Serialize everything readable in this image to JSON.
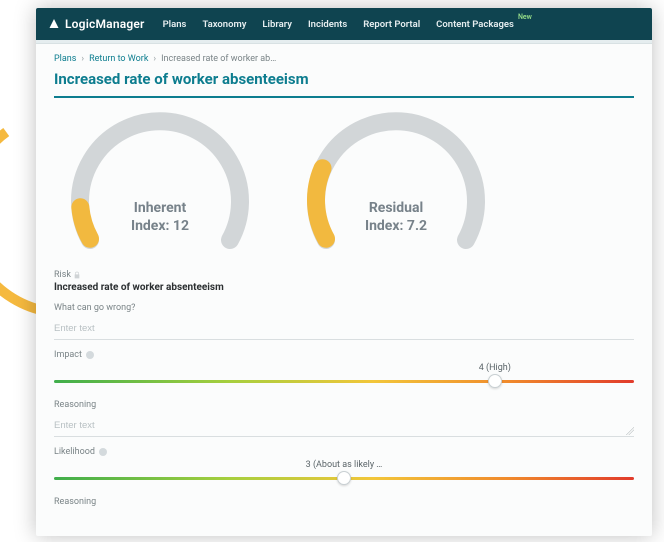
{
  "brand": "LogicManager",
  "nav": {
    "items": [
      "Plans",
      "Taxonomy",
      "Library",
      "Incidents",
      "Report Portal",
      "Content Packages"
    ],
    "new_badge": "New"
  },
  "breadcrumb": {
    "items": [
      "Plans",
      "Return to Work",
      "Increased rate of worker ab…"
    ]
  },
  "page_title": "Increased rate of worker absenteeism",
  "gauges": {
    "inherent": {
      "title": "Inherent",
      "index_label": "Index:",
      "value": 12,
      "fraction": 0.1
    },
    "residual": {
      "title": "Residual",
      "index_label": "Index:",
      "value": 7.2,
      "fraction": 0.22
    }
  },
  "risk": {
    "section_label": "Risk",
    "name": "Increased rate of worker absenteeism"
  },
  "fields": {
    "what_wrong": {
      "label": "What can go wrong?",
      "placeholder": "Enter text",
      "value": ""
    },
    "impact": {
      "label": "Impact",
      "value_label": "4 (High)",
      "position_pct": 76
    },
    "reasoning1": {
      "label": "Reasoning",
      "placeholder": "Enter text",
      "value": ""
    },
    "likelihood": {
      "label": "Likelihood",
      "value_label": "3 (About as likely …",
      "position_pct": 50
    },
    "reasoning2": {
      "label": "Reasoning"
    }
  },
  "colors": {
    "accent": "#0d7d8f",
    "gauge_fill": "#f2b93f",
    "gauge_track": "#d2d6d8"
  }
}
